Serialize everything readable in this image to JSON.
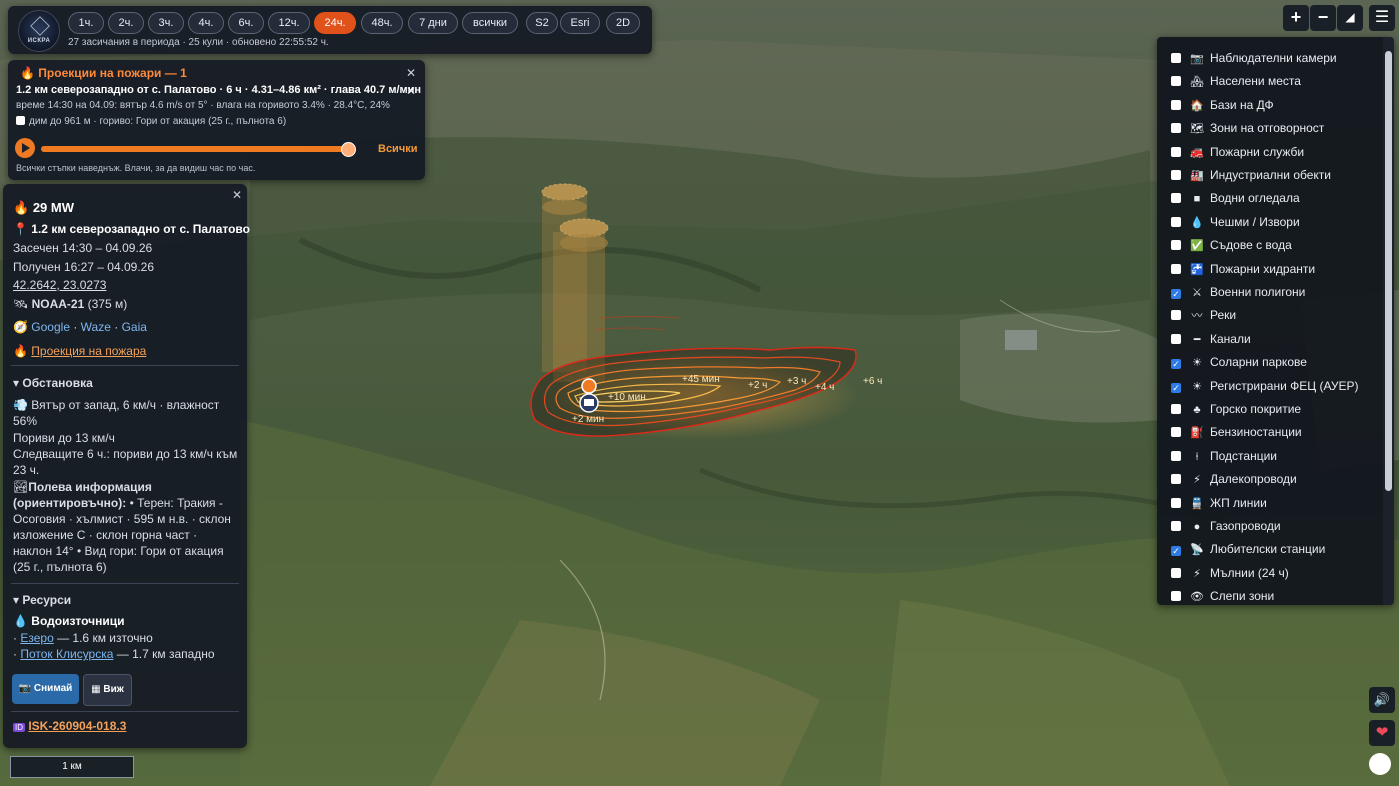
{
  "app": {
    "logo_text": "ИСКРА"
  },
  "topbar": {
    "periods": [
      "1ч.",
      "2ч.",
      "3ч.",
      "4ч.",
      "6ч.",
      "12ч.",
      "24ч.",
      "48ч.",
      "7 дни",
      "всички"
    ],
    "active_period": "24ч.",
    "sources": [
      "S2",
      "Esri"
    ],
    "view_mode": "2D",
    "status": "27 засичания в периода · 25 кули · обновено 22:55:52 ч."
  },
  "projection": {
    "title": "Проекции на пожари — 1",
    "main": "1.2 км северозападно от с. Палатово · 6 ч · 4.31–4.86 км² · глава 40.7 м/мин",
    "sub": "време 14:30 на 04.09: вятър 4.6 m/s от 5° · влага на горивото 3.4% · 28.4°C, 24%",
    "smoke_option": "дим до 961 м · гориво: Гори от акация (25 г., пълнота 6)",
    "slider_label": "Всички",
    "hint": "Всички стъпки наведнъж. Влачи, за да видиш час по час.",
    "progress": 1.0
  },
  "detail": {
    "power": "29 MW",
    "location": "1.2 км северозападно от с. Палатово",
    "detected": "Засечен 14:30 – 04.09.26",
    "received": "Получен 16:27 – 04.09.26",
    "coords": "42.2642, 23.0273",
    "satellite": "NOAA-21",
    "resolution": "(375 м)",
    "nav_links": [
      "Google",
      "Waze",
      "Gaia"
    ],
    "projection_link": "Проекция на пожара",
    "situation_title": "Обстановка",
    "wind": "Вятър от запад, 6 км/ч · влажност 56%",
    "gusts": "Пориви до 13 км/ч",
    "forecast": "Следващите 6 ч.: пориви до 13 км/ч към 23 ч.",
    "field_title": "Полева информация (ориентировъчно):",
    "field_text": "• Терен: Тракия - Осоговия · хълмист · 595 м н.в. · склон изложение С · склон горна част · наклон 14° • Вид гори: Гори от акация (25 г., пълнота 6)",
    "resources_title": "Ресурси",
    "water_title": "Водоизточници",
    "water": [
      {
        "name": "Езеро",
        "dist": "— 1.6 км източно"
      },
      {
        "name": "Поток Клисурска",
        "dist": "— 1.7 км западно"
      }
    ],
    "snap_button": "Снимай",
    "view_button": "Виж",
    "id": "ISK-260904-018.3"
  },
  "layers": [
    {
      "label": "Наблюдателни камери",
      "icon": "📷",
      "checked": false
    },
    {
      "label": "Населени места",
      "icon": "🏘",
      "checked": false
    },
    {
      "label": "Бази на ДФ",
      "icon": "🏠",
      "checked": false
    },
    {
      "label": "Зони на отговорност",
      "icon": "🗺",
      "checked": false
    },
    {
      "label": "Пожарни служби",
      "icon": "🚒",
      "checked": false
    },
    {
      "label": "Индустриални обекти",
      "icon": "🏭",
      "checked": false
    },
    {
      "label": "Водни огледала",
      "icon": "■",
      "checked": false
    },
    {
      "label": "Чешми / Извори",
      "icon": "💧",
      "checked": false
    },
    {
      "label": "Съдове с вода",
      "icon": "✅",
      "checked": false
    },
    {
      "label": "Пожарни хидранти",
      "icon": "🚰",
      "checked": false
    },
    {
      "label": "Военни полигони",
      "icon": "⚔",
      "checked": true
    },
    {
      "label": "Реки",
      "icon": "〰",
      "checked": false
    },
    {
      "label": "Канали",
      "icon": "━",
      "checked": false
    },
    {
      "label": "Соларни паркове",
      "icon": "☀",
      "checked": true
    },
    {
      "label": "Регистрирани ФЕЦ (АУЕР)",
      "icon": "☀",
      "checked": true
    },
    {
      "label": "Горско покритие",
      "icon": "♣",
      "checked": false
    },
    {
      "label": "Бензиностанции",
      "icon": "⛽",
      "checked": false
    },
    {
      "label": "Подстанции",
      "icon": "⍿",
      "checked": false
    },
    {
      "label": "Далекопроводи",
      "icon": "⚡",
      "checked": false
    },
    {
      "label": "ЖП линии",
      "icon": "🚆",
      "checked": false
    },
    {
      "label": "Газопроводи",
      "icon": "●",
      "checked": false
    },
    {
      "label": "Любителски станции",
      "icon": "📡",
      "checked": true
    },
    {
      "label": "Мълнии (24 ч)",
      "icon": "⚡",
      "checked": false
    },
    {
      "label": "Слепи зони",
      "icon": "👁",
      "checked": false
    }
  ],
  "map": {
    "scale": "1 км",
    "fire_labels": [
      "+10 мин",
      "+45 мин",
      "+2 ч",
      "+3 ч",
      "+4 ч",
      "+6 ч",
      "+2 мин"
    ]
  }
}
